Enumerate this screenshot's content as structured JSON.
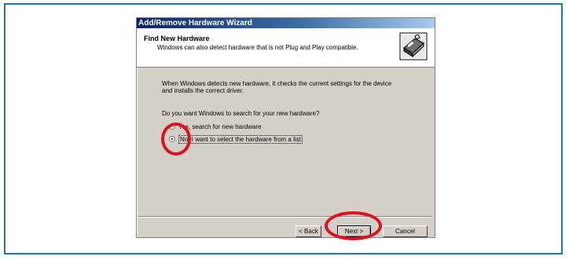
{
  "window": {
    "title": "Add/Remove Hardware Wizard"
  },
  "header": {
    "title": "Find New Hardware",
    "subtitle": "Windows can also detect hardware that is not Plug and Play compatible.",
    "icon": "hardware-wizard-icon"
  },
  "body": {
    "description_line1": "When Windows detects new hardware, it checks the current settings for the device",
    "description_line2": "and installs the correct driver.",
    "question": "Do you want Windows to search for your new hardware?",
    "options": [
      {
        "label": "Yes, search for new hardware",
        "selected": false
      },
      {
        "label": "No, I want to select the hardware from a list",
        "selected": true
      }
    ]
  },
  "buttons": {
    "back": "< Back",
    "next": "Next >",
    "cancel": "Cancel"
  },
  "colors": {
    "frame_border": "#1e74b8",
    "annotation": "#e0101e",
    "titlebar_start": "#0a246a",
    "titlebar_end": "#a6caf0"
  }
}
